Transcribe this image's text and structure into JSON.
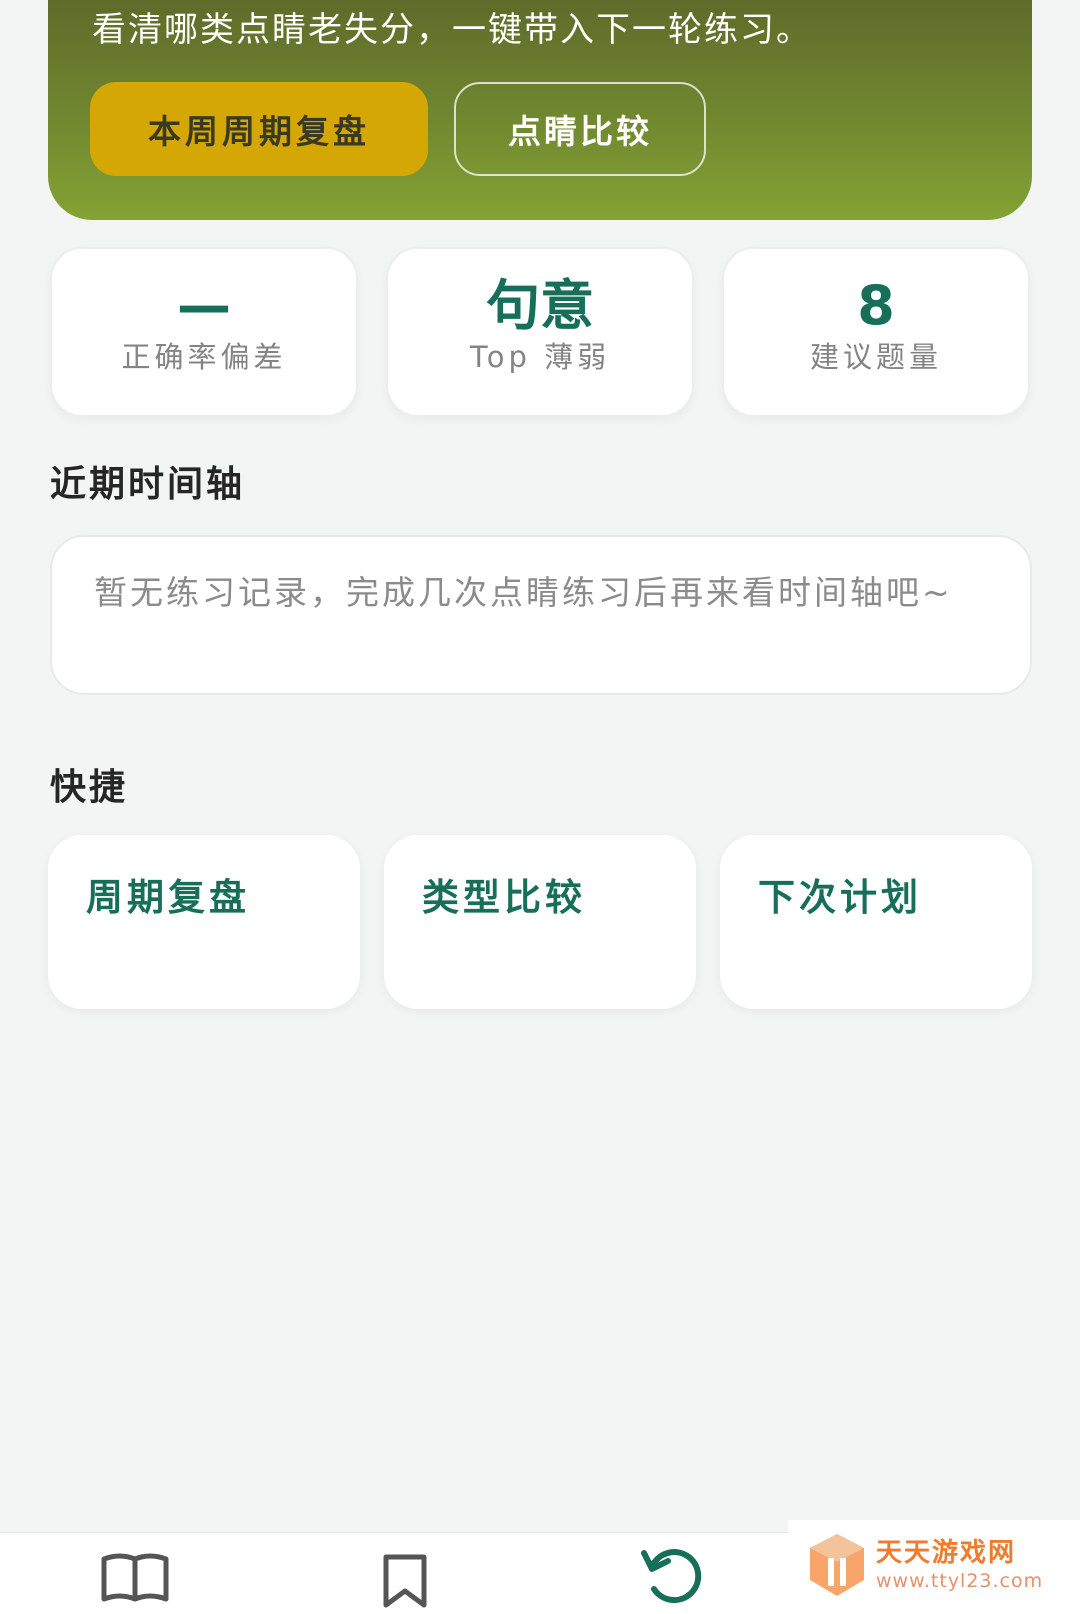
{
  "hero": {
    "subtitle": "看清哪类点睛老失分，一键带入下一轮练习。",
    "primary_button": "本周周期复盘",
    "secondary_button": "点睛比较"
  },
  "stats": [
    {
      "value": "—",
      "label": "正确率偏差"
    },
    {
      "value": "句意",
      "label": "Top 薄弱"
    },
    {
      "value": "8",
      "label": "建议题量"
    }
  ],
  "timeline": {
    "title": "近期时间轴",
    "empty_text": "暂无练习记录，完成几次点睛练习后再来看时间轴吧~"
  },
  "quick": {
    "title": "快捷",
    "items": [
      "周期复盘",
      "类型比较",
      "下次计划"
    ]
  },
  "bottom_nav": {
    "icons": [
      "book-icon",
      "bookmark-icon",
      "refresh-icon"
    ]
  },
  "watermark": {
    "title": "天天游戏网",
    "url": "www.ttyl23.com"
  },
  "colors": {
    "accent_green": "#176f5a",
    "hero_green": "#71882f",
    "gold": "#d4a705",
    "watermark_orange": "#ef7b2c"
  }
}
